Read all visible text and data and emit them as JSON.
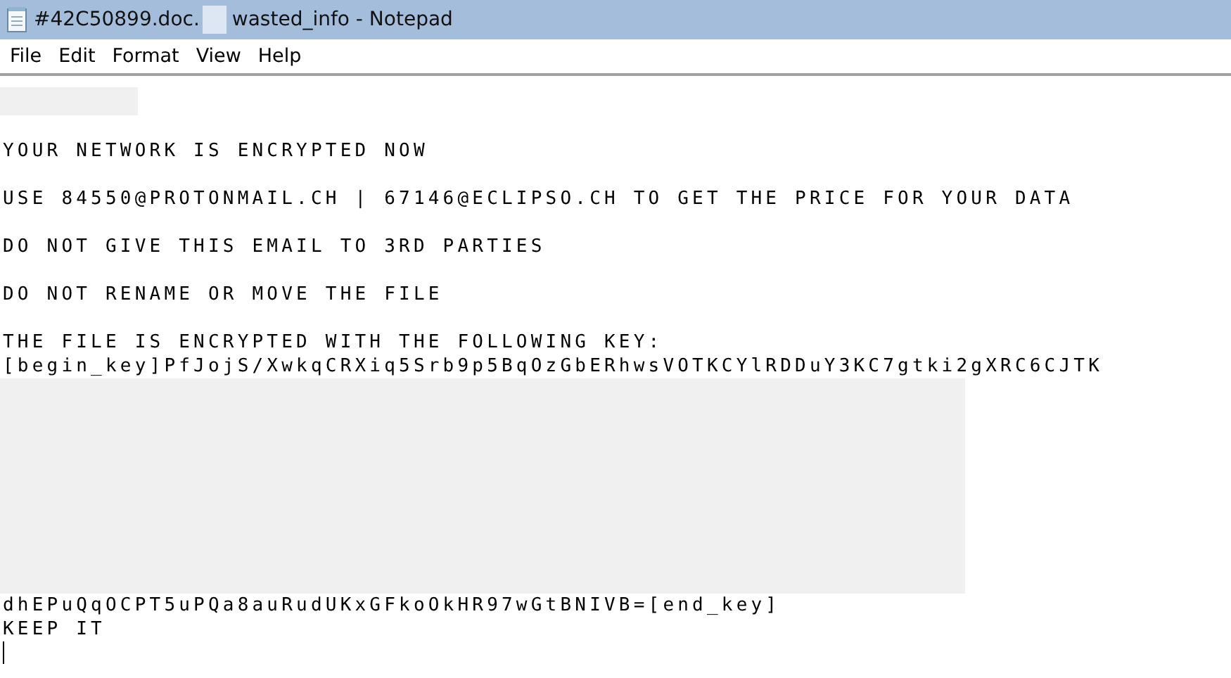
{
  "window": {
    "title_parts": [
      {
        "kind": "text",
        "text": "#42C50899.doc."
      },
      {
        "kind": "redacted"
      },
      {
        "kind": "text",
        "text": "wasted_info - Notepad"
      }
    ]
  },
  "menu": [
    "File",
    "Edit",
    "Format",
    "View",
    "Help"
  ],
  "document": {
    "lines": [
      {
        "kind": "redacted_short"
      },
      {
        "kind": "blank"
      },
      {
        "kind": "text",
        "text": "YOUR NETWORK IS ENCRYPTED NOW"
      },
      {
        "kind": "blank"
      },
      {
        "kind": "text",
        "text": "USE 84550@PROTONMAIL.CH | 67146@ECLIPSO.CH TO GET THE PRICE FOR YOUR DATA"
      },
      {
        "kind": "blank"
      },
      {
        "kind": "text",
        "text": "DO NOT GIVE THIS EMAIL TO 3RD PARTIES"
      },
      {
        "kind": "blank"
      },
      {
        "kind": "text",
        "text": "DO NOT RENAME OR MOVE THE FILE"
      },
      {
        "kind": "blank"
      },
      {
        "kind": "text",
        "text": "THE FILE IS ENCRYPTED WITH THE FOLLOWING KEY:"
      },
      {
        "kind": "text",
        "text": "[begin_key]PfJojS/XwkqCRXiq5Srb9p5BqOzGbERhwsVOTKCYlRDDuY3KC7gtki2gXRC6CJTK"
      },
      {
        "kind": "redacted_block"
      },
      {
        "kind": "text",
        "text": "dhEPuQqOCPT5uPQa8auRudUKxGFkoOkHR97wGtBNIVB=[end_key]"
      },
      {
        "kind": "text",
        "text": "KEEP IT"
      },
      {
        "kind": "caret"
      }
    ]
  }
}
